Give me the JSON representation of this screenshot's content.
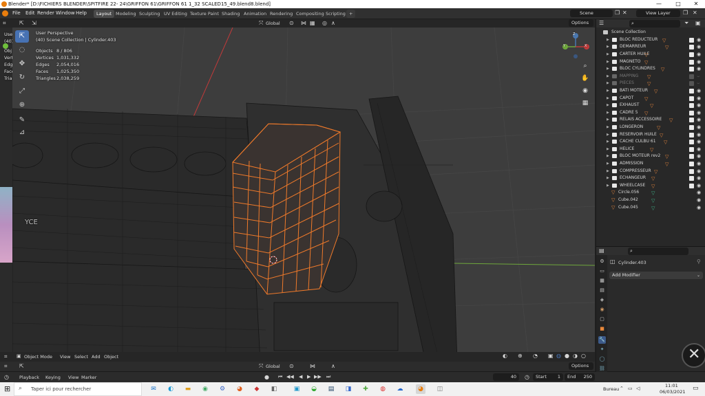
{
  "window": {
    "title": "Blender* [D:\\FICHIERS BLENDER\\SPITFIRE 22- 24\\GRIFFON 61\\GRIFFON 61  1_32 SCALED15_49.blend8.blend]",
    "minimize": "—",
    "maximize": "□",
    "close": "✕"
  },
  "menu": [
    "File",
    "Edit",
    "Render",
    "Window",
    "Help"
  ],
  "workspaces": [
    "Layout",
    "Modeling",
    "Sculpting",
    "UV Editing",
    "Texture Paint",
    "Shading",
    "Animation",
    "Rendering",
    "Compositing",
    "Scripting"
  ],
  "active_workspace": "Layout",
  "add_workspace": "+",
  "scene_name": "Scene",
  "view_layer": "View Layer",
  "viewport_header": {
    "orientation": "Global",
    "options": "Options"
  },
  "viewport_overlay": {
    "view_name": "User Perspective",
    "collection_line": "(40) Scene Collection | Cylinder.403",
    "stats": [
      {
        "label": "Objects",
        "value": "8 / 806"
      },
      {
        "label": "Vertices",
        "value": "1,031,332"
      },
      {
        "label": "Edges",
        "value": "2,054,016"
      },
      {
        "label": "Faces",
        "value": "1,025,350"
      },
      {
        "label": "Triangles",
        "value": "2,038,259"
      }
    ],
    "text_fragment": "YCE",
    "left_fragments": [
      "Use",
      "(40)",
      "Obj",
      "Vert",
      "Edg",
      "Face",
      "Tria"
    ]
  },
  "gizmo_labels": [
    "Y",
    "X",
    "Z"
  ],
  "viewport_footer": {
    "mode": "Object Mode",
    "menus": [
      "View",
      "Select",
      "Add",
      "Object"
    ]
  },
  "status_header": {
    "orientation": "Global",
    "options": "Options"
  },
  "timeline": {
    "menus": [
      "Playback",
      "Keying",
      "View",
      "Marker"
    ],
    "current_frame": "40",
    "start_label": "Start",
    "start": "1",
    "end_label": "End",
    "end": "250"
  },
  "outliner": {
    "root": "Scene Collection",
    "items": [
      {
        "label": "BLOC REDUCTEUR",
        "dim": false,
        "kind": "col"
      },
      {
        "label": "DEMARREUR",
        "dim": false,
        "kind": "col"
      },
      {
        "label": "CARTER HUILE",
        "dim": false,
        "kind": "col"
      },
      {
        "label": "MAGNETO",
        "dim": false,
        "kind": "col"
      },
      {
        "label": "BLOC CYLINDRES",
        "dim": false,
        "kind": "col"
      },
      {
        "label": "MAPPING",
        "dim": true,
        "kind": "col"
      },
      {
        "label": "PIECES",
        "dim": true,
        "kind": "col"
      },
      {
        "label": "BATI MOTEUR",
        "dim": false,
        "kind": "col"
      },
      {
        "label": "CAPOT",
        "dim": false,
        "kind": "col"
      },
      {
        "label": "EXHAUST",
        "dim": false,
        "kind": "col"
      },
      {
        "label": "CADRE 5",
        "dim": false,
        "kind": "col"
      },
      {
        "label": "RELAIS ACCESSOIRE",
        "dim": false,
        "kind": "col"
      },
      {
        "label": "LONGERON",
        "dim": false,
        "kind": "col"
      },
      {
        "label": "RESERVOIR HUILE",
        "dim": false,
        "kind": "col"
      },
      {
        "label": "CACHE CULBU 61",
        "dim": false,
        "kind": "col"
      },
      {
        "label": "HELICE",
        "dim": false,
        "kind": "col"
      },
      {
        "label": "BLOC MOTEUR rev2",
        "dim": false,
        "kind": "col"
      },
      {
        "label": "ADMISSION",
        "dim": false,
        "kind": "col"
      },
      {
        "label": "COMPRESSEUR",
        "dim": false,
        "kind": "col"
      },
      {
        "label": "ECHANGEUR",
        "dim": false,
        "kind": "col"
      },
      {
        "label": "WHEELCASE",
        "dim": false,
        "kind": "col"
      },
      {
        "label": "Circle.056",
        "dim": false,
        "kind": "obj"
      },
      {
        "label": "Cube.042",
        "dim": false,
        "kind": "obj"
      },
      {
        "label": "Cube.045",
        "dim": false,
        "kind": "obj"
      }
    ]
  },
  "properties": {
    "object_name": "Cylinder.403",
    "add_modifier": "Add Modifier"
  },
  "taskbar": {
    "search_placeholder": "Taper ici pour rechercher",
    "desktop_label": "Bureau",
    "time": "11:01",
    "date": "06/03/2021"
  },
  "colors": {
    "selection_orange": "#f07a2a",
    "axis_red": "#c23a3a",
    "axis_green": "#6fa83c",
    "active_tool": "#4772b3",
    "blender_logo": "#e87d0d"
  }
}
